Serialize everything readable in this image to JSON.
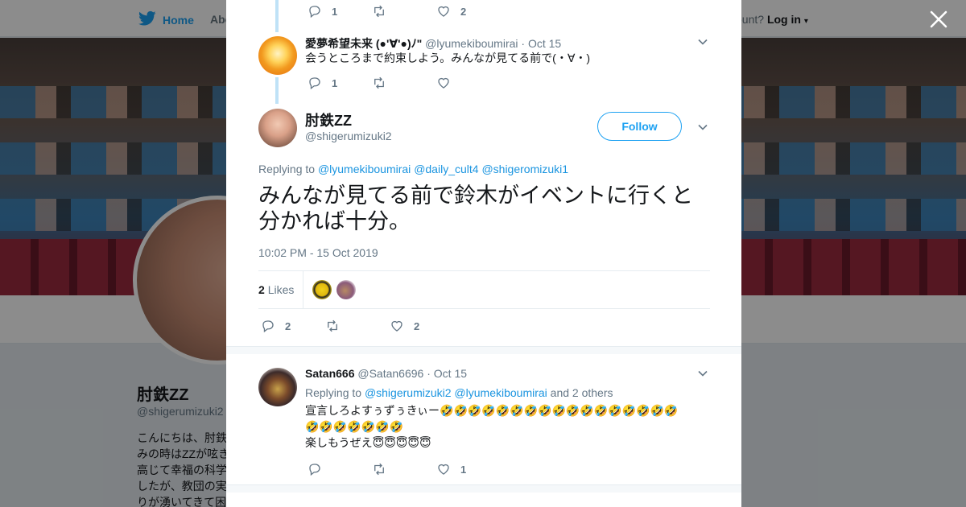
{
  "nav": {
    "home_label": "Home",
    "about_label": "Abo",
    "account_prompt": "ccount?",
    "login_label": "Log in"
  },
  "profile_bg": {
    "name": "肘鉄ZZ",
    "handle": "@shigerumizuki2",
    "bio": "こんにちは、肘鉄\nみの時はZZが呟き\n高じて幸福の科学\nしたが、教団の実\nりが湧いてきて困"
  },
  "thread": [
    {
      "replies": "1",
      "retweets": "",
      "likes": "2"
    },
    {
      "name": "愛夢希望未来 (●'∀'●)ﾉ\"",
      "handle": "@lyumekiboumirai",
      "date": "Oct 15",
      "text": "会うところまで約束しよう。みんなが見てる前で(・∀・)",
      "replies": "1",
      "retweets": "",
      "likes": ""
    }
  ],
  "focus": {
    "name": "肘鉄ZZ",
    "handle": "@shigerumizuki2",
    "follow_label": "Follow",
    "replying_prefix": "Replying to",
    "replying_to": [
      "@lyumekiboumirai",
      "@daily_cult4",
      "@shigeromizuki1"
    ],
    "text": "みんなが見てる前で鈴木がイベントに行くと分かれば十分。",
    "timestamp": "10:02 PM - 15 Oct 2019",
    "likes_count": "2",
    "likes_label": "Likes",
    "replies": "2",
    "retweets": "",
    "likes": "2"
  },
  "reply": {
    "name": "Satan666",
    "handle": "@Satan6696",
    "date": "Oct 15",
    "replying_prefix": "Replying to",
    "replying_to": [
      "@shigerumizuki2",
      "@lyumekiboumirai"
    ],
    "replying_suffix": "and 2 others",
    "text_line1": "宣言しろよすぅずぅきぃー🤣🤣🤣🤣🤣🤣🤣🤣🤣🤣🤣🤣🤣🤣🤣🤣🤣",
    "text_line2": "🤣🤣🤣🤣🤣🤣🤣",
    "text_line3": "楽しもうぜえ😇😇😇😇😇",
    "replies": "",
    "retweets": "",
    "likes": "1"
  },
  "colors": {
    "accent": "#1da1f2",
    "link": "#1b95e0",
    "muted": "#657786",
    "thread_line": "#bfe2f7"
  }
}
